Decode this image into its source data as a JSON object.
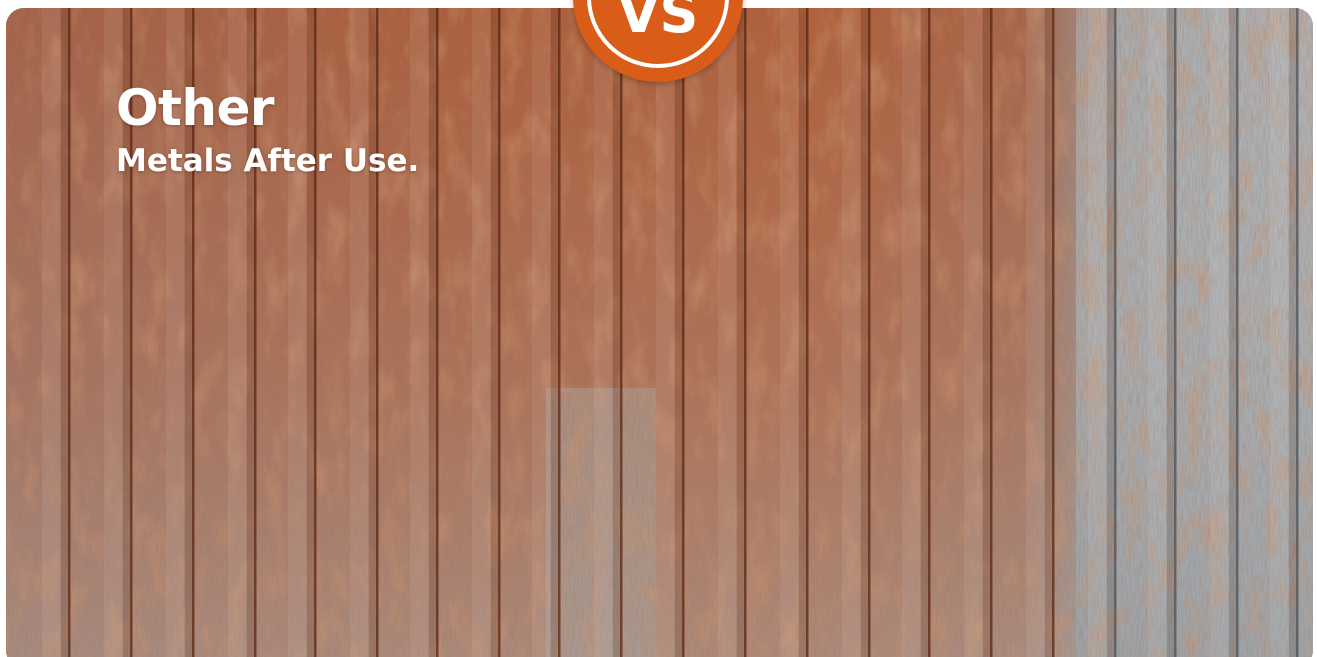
{
  "panel": {
    "title": "Other",
    "subtitle": "Metals After Use.",
    "subject": "rusted corrugated metal sheet"
  },
  "badge": {
    "label": "VS",
    "color": "#d95c18"
  },
  "colors": {
    "rust": "#b05a34",
    "galvanized": "#a9aeb3",
    "text": "#ffffff"
  }
}
